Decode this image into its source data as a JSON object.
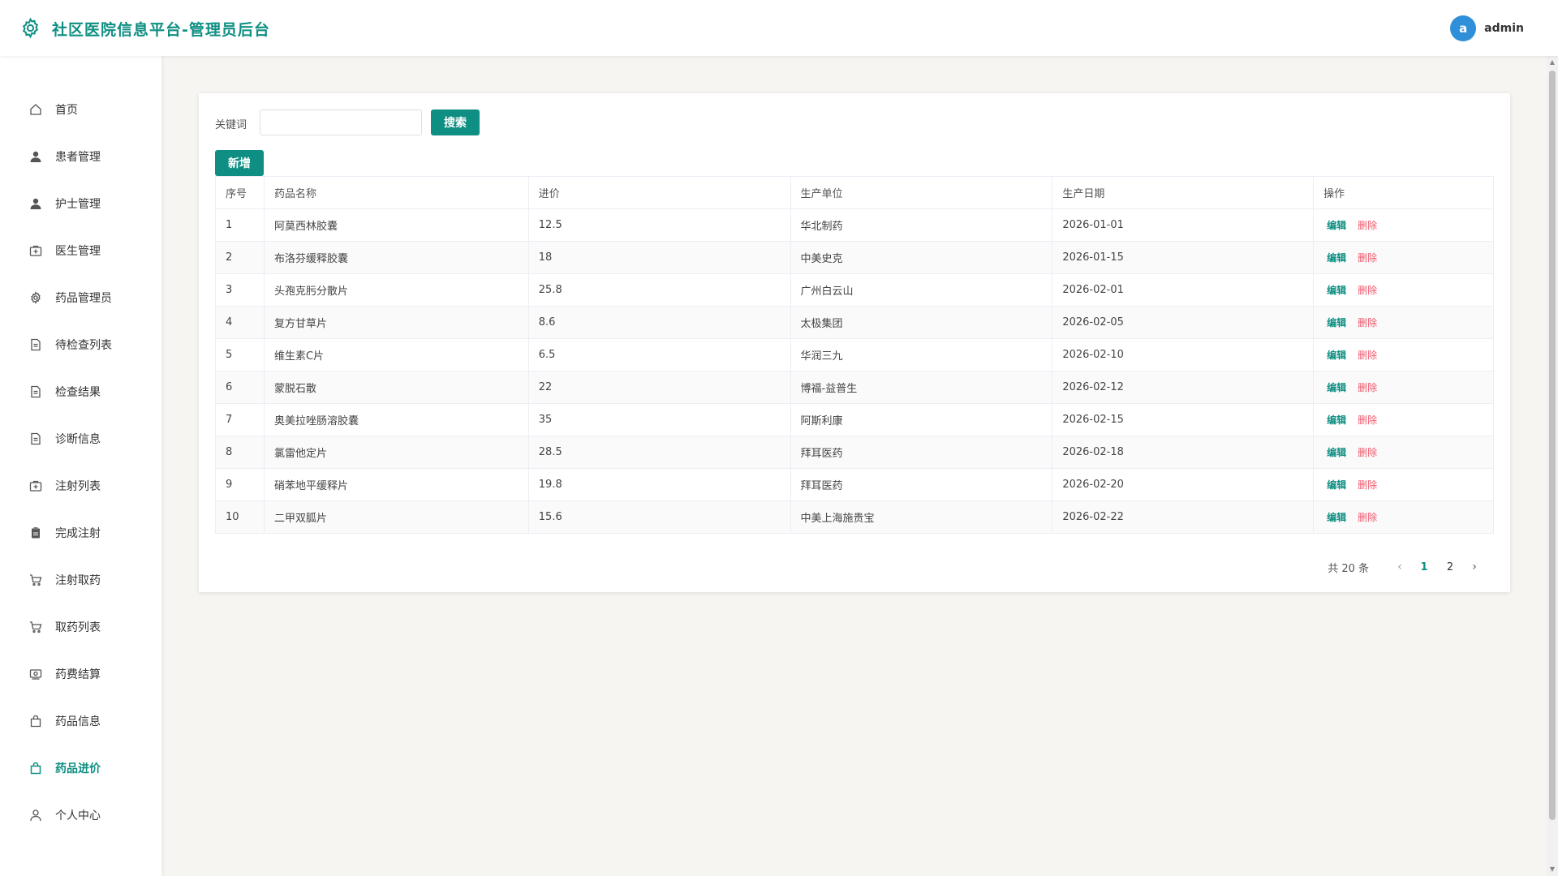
{
  "header": {
    "title": "社区医院信息平台-管理员后台",
    "avatar_letter": "a",
    "username": "admin",
    "logo_icon": "gear-icon"
  },
  "sidebar": {
    "items": [
      {
        "label": "首页",
        "icon": "home-icon"
      },
      {
        "label": "患者管理",
        "icon": "user-filled-icon"
      },
      {
        "label": "护士管理",
        "icon": "user-filled-icon"
      },
      {
        "label": "医生管理",
        "icon": "first-aid-icon"
      },
      {
        "label": "药品管理员",
        "icon": "gear-icon"
      },
      {
        "label": "待检查列表",
        "icon": "document-icon"
      },
      {
        "label": "检查结果",
        "icon": "document-icon"
      },
      {
        "label": "诊断信息",
        "icon": "document-icon"
      },
      {
        "label": "注射列表",
        "icon": "first-aid-icon"
      },
      {
        "label": "完成注射",
        "icon": "clipboard-icon"
      },
      {
        "label": "注射取药",
        "icon": "cart-icon"
      },
      {
        "label": "取药列表",
        "icon": "cart-icon"
      },
      {
        "label": "药费结算",
        "icon": "money-icon"
      },
      {
        "label": "药品信息",
        "icon": "bag-icon"
      },
      {
        "label": "药品进价",
        "icon": "bag-icon"
      },
      {
        "label": "个人中心",
        "icon": "user-outline-icon"
      }
    ],
    "active_index": 14
  },
  "search": {
    "label": "关键词",
    "value": "",
    "placeholder": "",
    "button_label": "搜索"
  },
  "toolbar": {
    "add_label": "新增"
  },
  "table": {
    "columns": [
      "序号",
      "药品名称",
      "进价",
      "生产单位",
      "生产日期",
      "操作"
    ],
    "rows": [
      [
        "1",
        "阿莫西林胶囊",
        "12.5",
        "华北制药",
        "2026-01-01"
      ],
      [
        "2",
        "布洛芬缓释胶囊",
        "18",
        "中美史克",
        "2026-01-15"
      ],
      [
        "3",
        "头孢克肟分散片",
        "25.8",
        "广州白云山",
        "2026-02-01"
      ],
      [
        "4",
        "复方甘草片",
        "8.6",
        "太极集团",
        "2026-02-05"
      ],
      [
        "5",
        "维生素C片",
        "6.5",
        "华润三九",
        "2026-02-10"
      ],
      [
        "6",
        "蒙脱石散",
        "22",
        "博福-益普生",
        "2026-02-12"
      ],
      [
        "7",
        "奥美拉唑肠溶胶囊",
        "35",
        "阿斯利康",
        "2026-02-15"
      ],
      [
        "8",
        "氯雷他定片",
        "28.5",
        "拜耳医药",
        "2026-02-18"
      ],
      [
        "9",
        "硝苯地平缓释片",
        "19.8",
        "拜耳医药",
        "2026-02-20"
      ],
      [
        "10",
        "二甲双胍片",
        "15.6",
        "中美上海施贵宝",
        "2026-02-22"
      ]
    ],
    "edit_label": "编辑",
    "delete_label": "删除"
  },
  "pagination": {
    "total_text": "共 20 条",
    "pages": [
      "1",
      "2"
    ],
    "current": "1"
  },
  "colors": {
    "accent": "#0f8f83",
    "danger": "#f0566a",
    "avatar": "#2f8fd8"
  }
}
